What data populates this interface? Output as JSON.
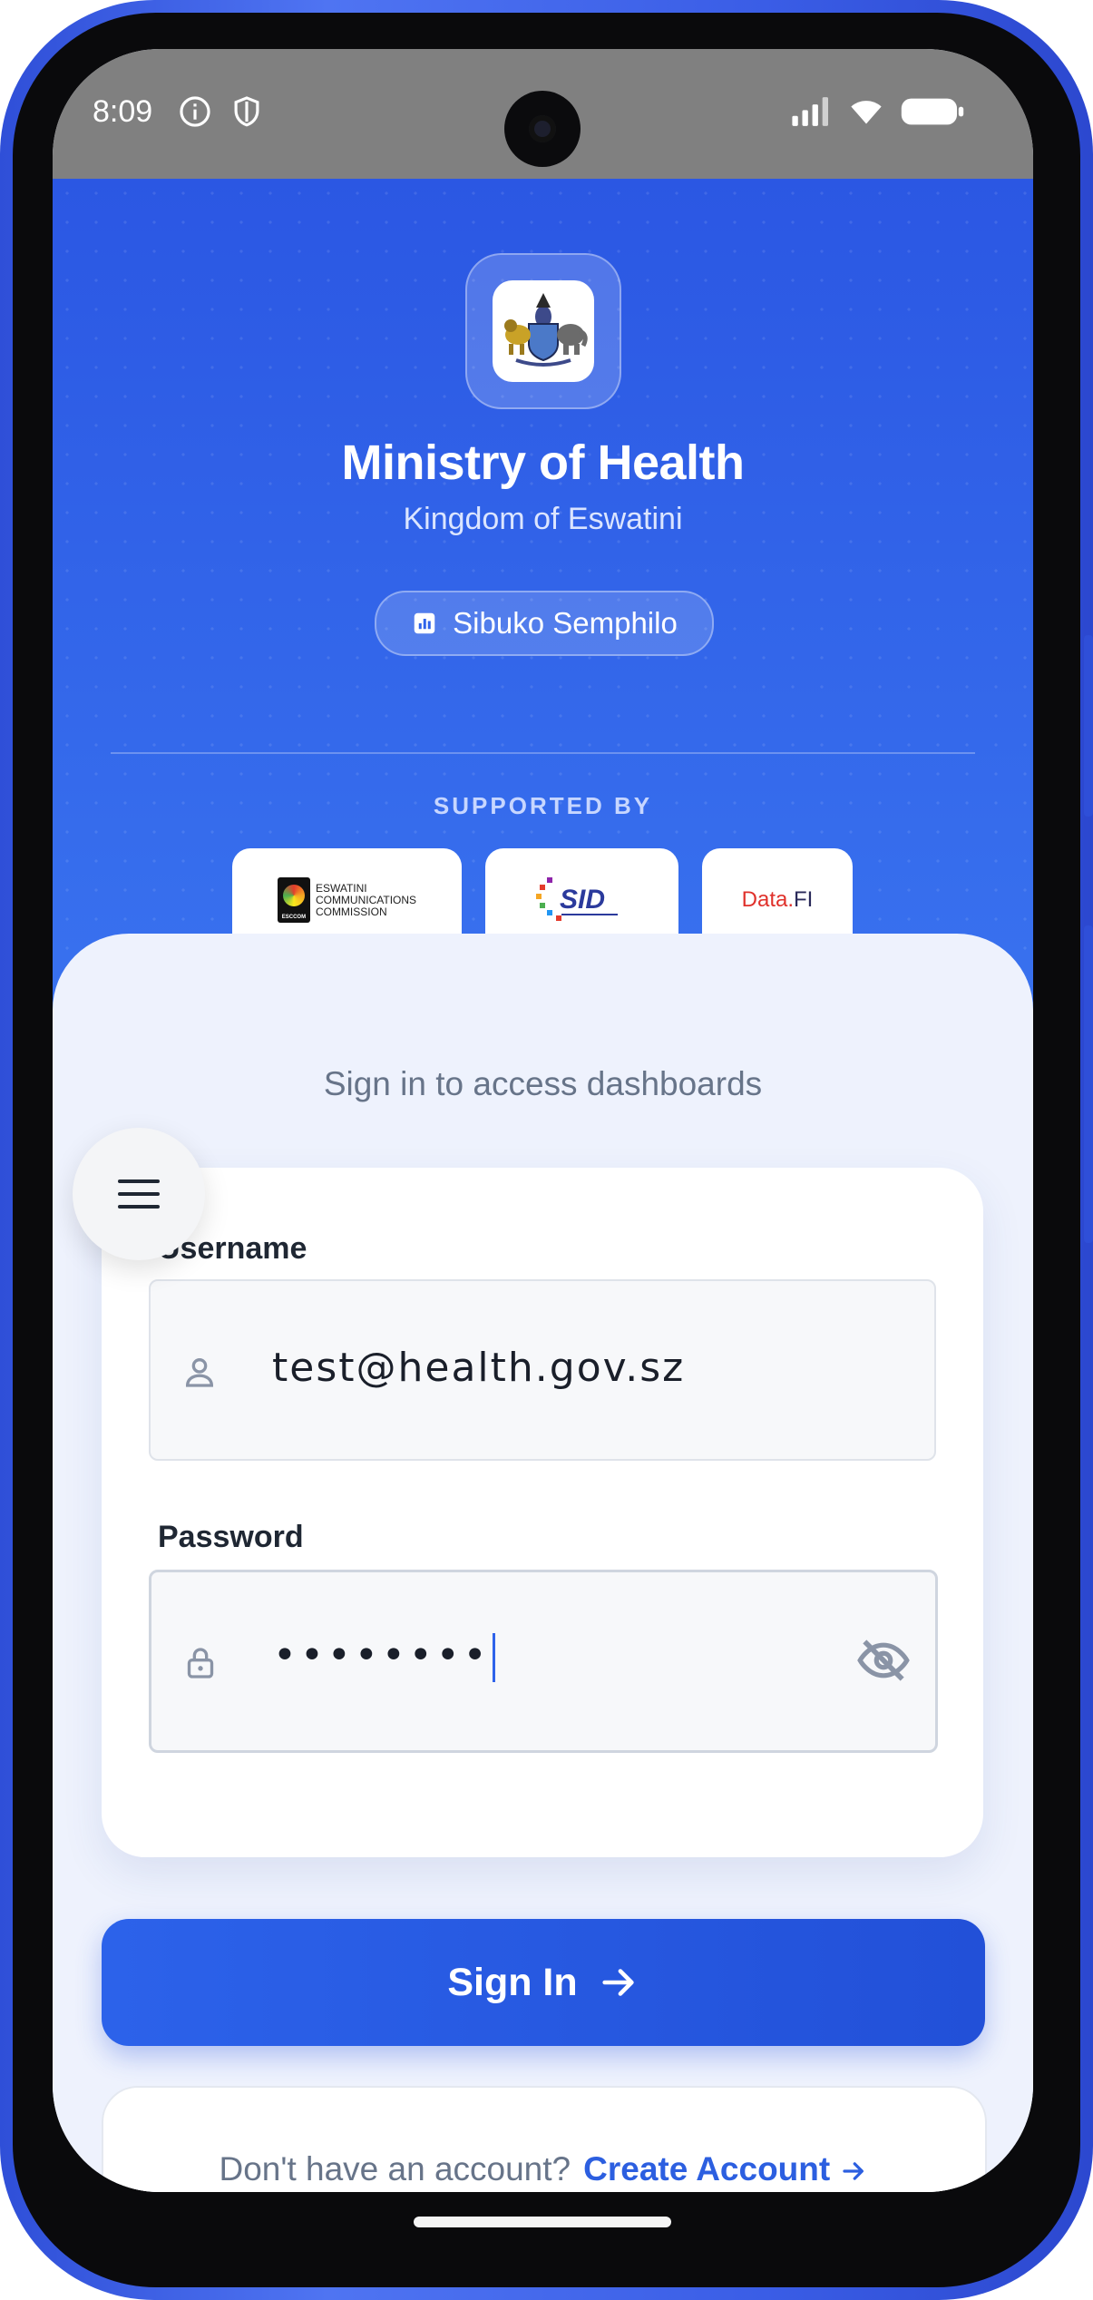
{
  "status_bar": {
    "time": "8:09",
    "icons": [
      "info-icon",
      "shield-icon",
      "signal-icon",
      "wifi-icon",
      "battery-icon"
    ]
  },
  "header": {
    "title": "Ministry of Health",
    "subtitle": "Kingdom of Eswatini",
    "badge_label": "Sibuko Semphilo",
    "badge_icon": "bar-chart-icon",
    "supported_by": "SUPPORTED BY",
    "sponsors": [
      {
        "name": "ESWATINI COMMUNICATIONS COMMISSION",
        "line1": "ESWATINI",
        "line2": "COMMUNICATIONS",
        "line3": "COMMISSION",
        "mark": "ESCCOM"
      },
      {
        "name": "SID",
        "mark": "SID"
      },
      {
        "name": "Data.FI",
        "mark_a": "Data.",
        "mark_b": "FI"
      }
    ]
  },
  "form": {
    "intro": "Sign in to access dashboards",
    "username_label": "Username",
    "username_value": "test@health.gov.sz",
    "password_label": "Password",
    "password_value": "••••••••",
    "submit_label": "Sign In"
  },
  "footer": {
    "prompt": "Don't have an account?",
    "link": "Create Account"
  },
  "colors": {
    "primary": "#2c62ea",
    "link": "#2c5fe0",
    "muted": "#677489"
  }
}
